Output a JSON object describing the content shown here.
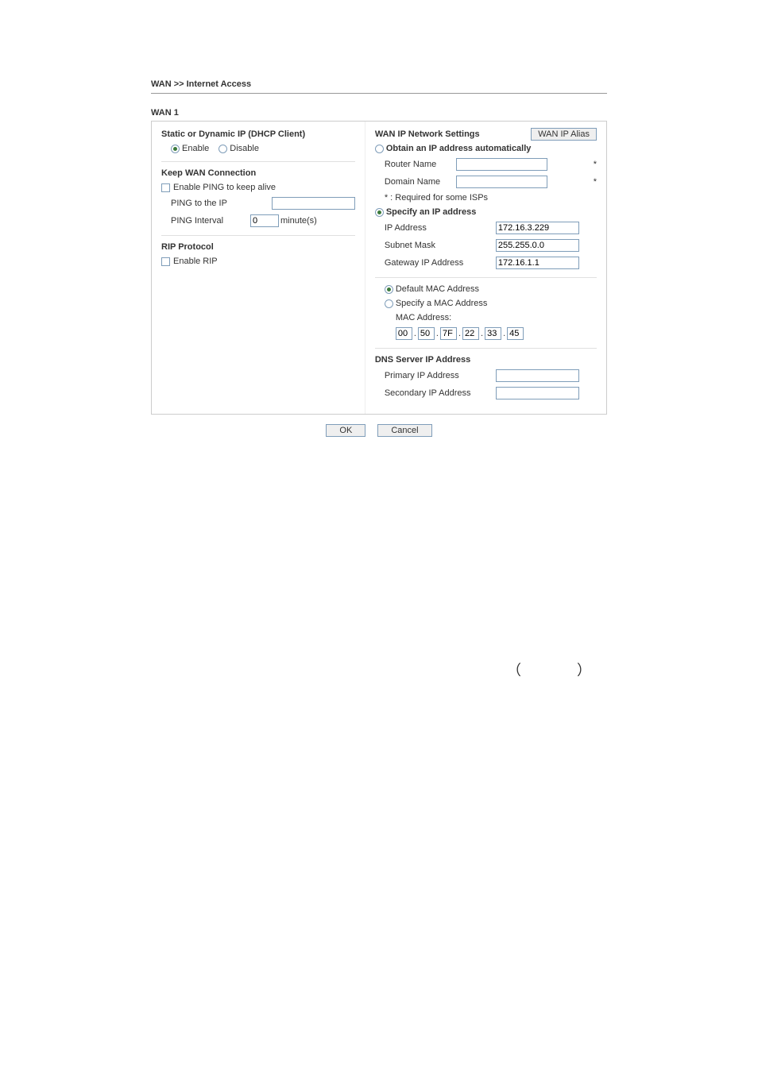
{
  "breadcrumb": "WAN >> Internet Access",
  "wanTitle": "WAN 1",
  "left": {
    "connTypeTitle": "Static or Dynamic IP (DHCP Client)",
    "enableLabel": "Enable",
    "disableLabel": "Disable",
    "keepWanTitle": "Keep WAN Connection",
    "enablePingLabel": "Enable PING to keep alive",
    "pingToIpLabel": "PING to the IP",
    "pingToIpValue": "",
    "pingIntervalLabel": "PING Interval",
    "pingIntervalValue": "0",
    "pingIntervalUnit": "minute(s)",
    "ripTitle": "RIP Protocol",
    "enableRipLabel": "Enable RIP"
  },
  "right": {
    "wanIpTitle": "WAN IP Network Settings",
    "aliasBtn": "WAN IP Alias",
    "obtainAutoLabel": "Obtain an IP address automatically",
    "routerNameLabel": "Router Name",
    "routerNameValue": "",
    "domainNameLabel": "Domain Name",
    "domainNameValue": "",
    "requiredNote": "* : Required for some ISPs",
    "specifyIpLabel": "Specify an IP address",
    "ipAddrLabel": "IP Address",
    "ipAddrValue": "172.16.3.229",
    "subnetLabel": "Subnet Mask",
    "subnetValue": "255.255.0.0",
    "gatewayLabel": "Gateway IP Address",
    "gatewayValue": "172.16.1.1",
    "defaultMacLabel": "Default MAC Address",
    "specifyMacLabel": "Specify a MAC Address",
    "macAddrLabel": "MAC Address:",
    "mac": [
      "00",
      "50",
      "7F",
      "22",
      "33",
      "45"
    ],
    "dnsTitle": "DNS Server IP Address",
    "primaryLabel": "Primary IP Address",
    "primaryValue": "",
    "secondaryLabel": "Secondary IP Address",
    "secondaryValue": ""
  },
  "buttons": {
    "ok": "OK",
    "cancel": "Cancel"
  },
  "parens": {
    "open": "（",
    "close": "）"
  }
}
